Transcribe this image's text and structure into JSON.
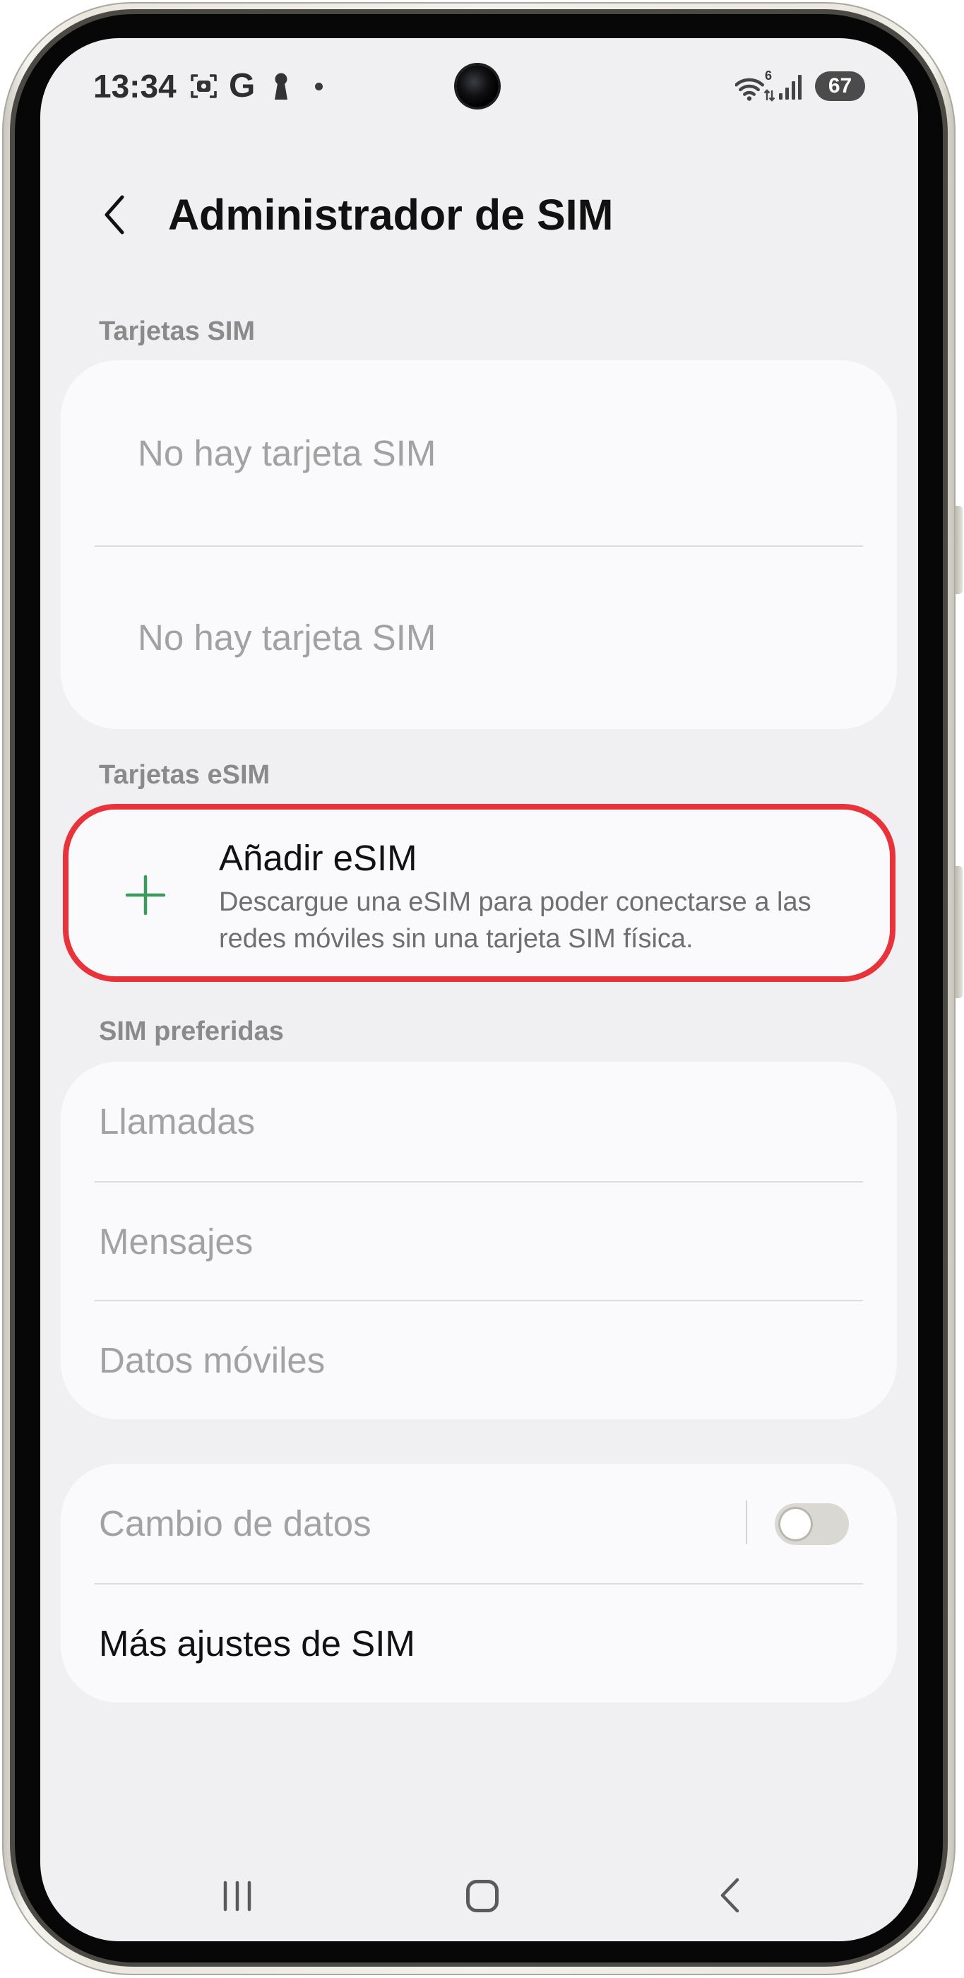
{
  "status_bar": {
    "time": "13:34",
    "google_letter": "G",
    "wifi_standard": "6",
    "battery_level": "67",
    "left_icons": [
      "screenshot-icon",
      "google-icon",
      "keyhole-icon",
      "notification-dot-icon"
    ],
    "right_icons": [
      "wifi-icon",
      "signal-icon",
      "battery-icon"
    ]
  },
  "header": {
    "back_icon": "chevron-left-icon",
    "title": "Administrador de SIM"
  },
  "sim_cards": {
    "section_label": "Tarjetas SIM",
    "slots": [
      {
        "label": "No hay tarjeta SIM"
      },
      {
        "label": "No hay tarjeta SIM"
      }
    ]
  },
  "esim_cards": {
    "section_label": "Tarjetas eSIM",
    "add_esim": {
      "icon": "plus-icon",
      "title": "Añadir eSIM",
      "description": [
        "Descargue una eSIM para poder conectarse a las",
        "redes móviles sin una tarjeta SIM física."
      ]
    }
  },
  "preferred_sim": {
    "section_label": "SIM preferidas",
    "items": [
      {
        "label": "Llamadas"
      },
      {
        "label": "Mensajes"
      },
      {
        "label": "Datos móviles"
      }
    ]
  },
  "other_settings": {
    "data_switching": {
      "label": "Cambio de datos",
      "enabled": false
    },
    "more_settings": {
      "label": "Más ajustes de SIM"
    }
  },
  "nav_bar": {
    "icons": [
      "recents-icon",
      "home-icon",
      "back-icon"
    ]
  },
  "colors": {
    "screen_background": "#f0f0f2",
    "card_background": "#fafafc",
    "highlight_border": "#e8333b",
    "plus_icon": "#3a9b5a",
    "disabled_text": "#a2a2a2",
    "section_label": "#8a8a8a",
    "primary_text": "#111111",
    "secondary_text": "#6f6f6f",
    "phone_frame": "#e9e7de"
  }
}
